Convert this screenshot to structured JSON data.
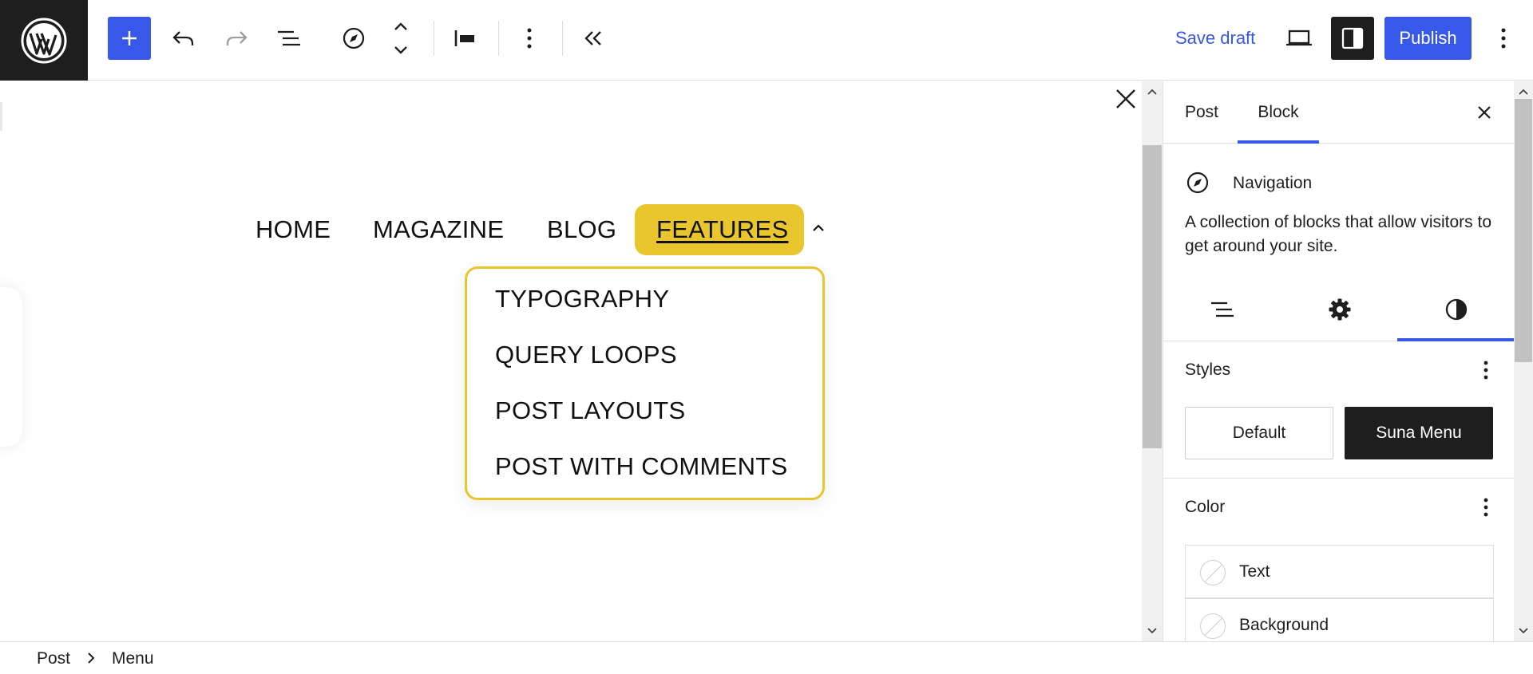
{
  "toolbar": {
    "save_draft_label": "Save draft",
    "publish_label": "Publish"
  },
  "canvas": {
    "nav_items": [
      "HOME",
      "MAGAZINE",
      "BLOG"
    ],
    "nav_active": "FEATURES",
    "submenu_items": [
      "TYPOGRAPHY",
      "QUERY LOOPS",
      "POST LAYOUTS",
      "POST WITH COMMENTS"
    ],
    "highlight_color": "#e9c62e"
  },
  "sidebar": {
    "tabs": [
      "Post",
      "Block"
    ],
    "active_tab": "Block",
    "block_title": "Navigation",
    "block_description": "A collection of blocks that allow visitors to get around your site.",
    "styles_title": "Styles",
    "style_options": [
      "Default",
      "Suna Menu"
    ],
    "selected_style": "Suna Menu",
    "color_title": "Color",
    "color_items": [
      "Text",
      "Background"
    ]
  },
  "footer": {
    "breadcrumb": [
      "Post",
      "Menu"
    ]
  },
  "colors": {
    "accent": "#3858e9",
    "dark": "#1e1e1e"
  }
}
